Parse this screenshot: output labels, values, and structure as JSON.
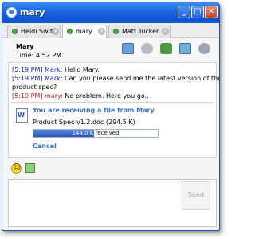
{
  "window": {
    "title": "mary"
  },
  "tabs": [
    {
      "label": "Heidi Swift",
      "active": false
    },
    {
      "label": "mary",
      "active": true
    },
    {
      "label": "Matt Tucker",
      "active": false
    }
  ],
  "header": {
    "contact_name": "Mary",
    "local_time": "Time: 4:52 PM"
  },
  "messages": [
    {
      "time": "[5:19 PM]",
      "sender": "Mark:",
      "lines": [
        "Hello Mary."
      ],
      "color": "blue"
    },
    {
      "time": "[5:19 PM]",
      "sender": "Mark:",
      "lines": [
        "Can you please send me the latest version of the",
        "product spec?"
      ],
      "color": "blue"
    },
    {
      "time": "[5:19 PM]",
      "sender": "mary:",
      "lines": [
        "No problem. Here you go.."
      ],
      "color": "red"
    }
  ],
  "file_transfer": {
    "title": "You are receiving a file from Mary",
    "file": "Product Spec v1.2.doc (294.5 K)",
    "amount": "144.0 K",
    "status": "received",
    "progress_fraction": 0.49,
    "cancel_label": "Cancel"
  },
  "compose": {
    "send_label": "Send"
  },
  "colors": {
    "accent": "#3c6fd0",
    "titlebar": "#1c64e0",
    "progress": "#2b56b8"
  }
}
